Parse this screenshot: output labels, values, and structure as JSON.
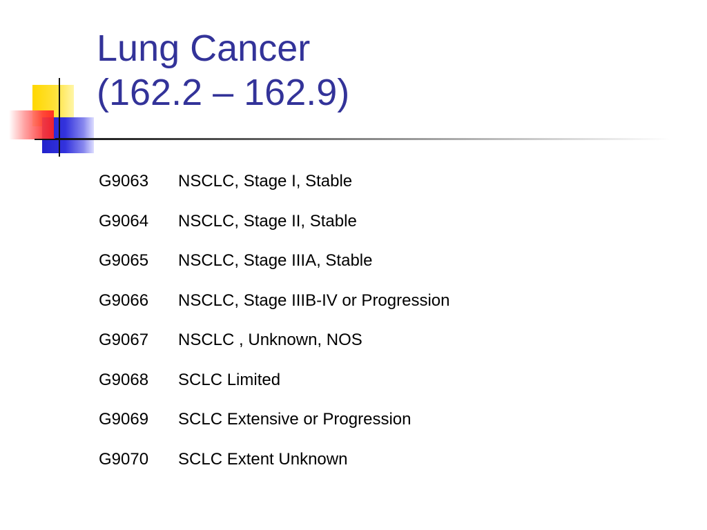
{
  "slide": {
    "title_lines": [
      "Lung Cancer",
      "(162.2 – 162.9)"
    ],
    "items": [
      {
        "code": "G9063",
        "description": "NSCLC, Stage I, Stable"
      },
      {
        "code": "G9064",
        "description": "NSCLC, Stage II, Stable"
      },
      {
        "code": "G9065",
        "description": "NSCLC, Stage IIIA, Stable"
      },
      {
        "code": "G9066",
        "description": "NSCLC, Stage IIIB-IV or Progression"
      },
      {
        "code": "G9067",
        "description": "NSCLC , Unknown, NOS"
      },
      {
        "code": "G9068",
        "description": "SCLC Limited"
      },
      {
        "code": "G9069",
        "description": "SCLC Extensive or Progression"
      },
      {
        "code": "G9070",
        "description": "SCLC Extent Unknown"
      }
    ]
  },
  "colors": {
    "title": "#333399",
    "body_text": "#000000",
    "accent_yellow": "#ffd700",
    "accent_blue": "#2222cc",
    "accent_red": "#ff2020"
  }
}
